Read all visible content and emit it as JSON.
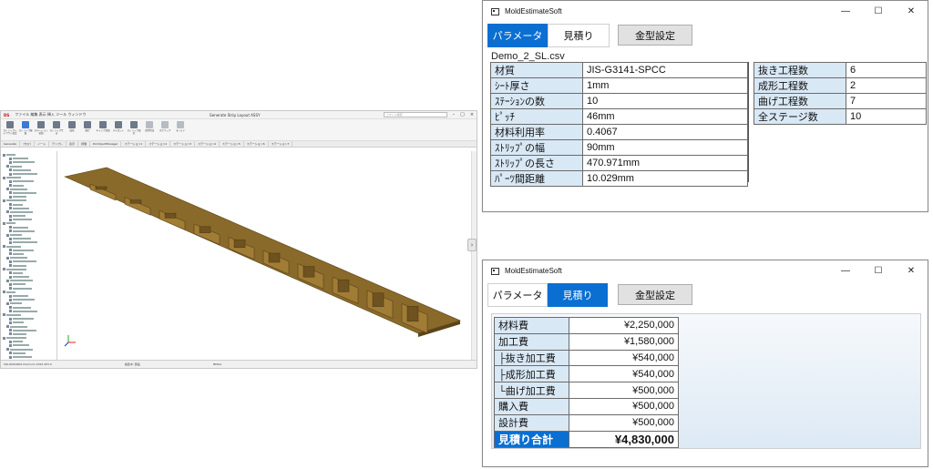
{
  "cad": {
    "title": "Generate Strip Layout ASSY",
    "search_placeholder": "コマンド検索",
    "ribbon": [
      "ストリップレイアウト設定",
      "ストリップ編集",
      "ステーション追加",
      "ストリップ寸法",
      "成形",
      "曲げ",
      "キャリア追加",
      "パイロット",
      "ストリップ設定",
      "金型作成",
      "スクラップ",
      "モールド"
    ],
    "tabs": [
      "Generate",
      "プロパ",
      "ノート",
      "テンプレ",
      "表示",
      "評価",
      "DimXpertManager",
      "ステーション1",
      "ステーション2",
      "ステーション3",
      "ステーション4",
      "ステーション5",
      "ステーション6",
      "ステーション7"
    ],
    "status_left": "SOLIDWORKS Premium 2024 SP3.0",
    "status_right": "編集中: 部品",
    "units": "MMGS"
  },
  "win1": {
    "title": "MoldEstimateSoft",
    "tab_params": "パラメータ",
    "tab_estimate": "見積り",
    "mold_button": "金型設定",
    "filename": "Demo_2_SL.csv",
    "params": [
      {
        "k": "材質",
        "v": "JIS-G3141-SPCC"
      },
      {
        "k": "ｼｰﾄ厚さ",
        "v": "1mm"
      },
      {
        "k": "ｽﾃｰｼｮﾝの数",
        "v": "10"
      },
      {
        "k": "ﾋﾟｯﾁ",
        "v": "46mm"
      },
      {
        "k": "材料利用率",
        "v": "0.4067"
      },
      {
        "k": "ｽﾄﾘｯﾌﾟの幅",
        "v": "90mm"
      },
      {
        "k": "ｽﾄﾘｯﾌﾟの長さ",
        "v": "470.971mm"
      },
      {
        "k": "ﾊﾟｰﾂ間距離",
        "v": "10.029mm"
      }
    ],
    "process": [
      {
        "k": "抜き工程数",
        "v": "6"
      },
      {
        "k": "成形工程数",
        "v": "2"
      },
      {
        "k": "曲げ工程数",
        "v": "7"
      },
      {
        "k": "全ステージ数",
        "v": "10"
      }
    ]
  },
  "win2": {
    "title": "MoldEstimateSoft",
    "tab_params": "パラメータ",
    "tab_estimate": "見積り",
    "mold_button": "金型設定",
    "costs": [
      {
        "k": "材料費",
        "v": "¥2,250,000"
      },
      {
        "k": "加工費",
        "v": "¥1,580,000"
      },
      {
        "k": "├抜き加工費",
        "v": "¥540,000"
      },
      {
        "k": "├成形加工費",
        "v": "¥540,000"
      },
      {
        "k": "└曲げ加工費",
        "v": "¥500,000"
      },
      {
        "k": "購入費",
        "v": "¥500,000"
      },
      {
        "k": "設計費",
        "v": "¥500,000"
      }
    ],
    "total": {
      "k": "見積り合計",
      "v": "¥4,830,000"
    }
  },
  "colors": {
    "accent": "#0a6fd1",
    "key_cell": "#d9e8f5",
    "strip": "#8a6a2a"
  }
}
